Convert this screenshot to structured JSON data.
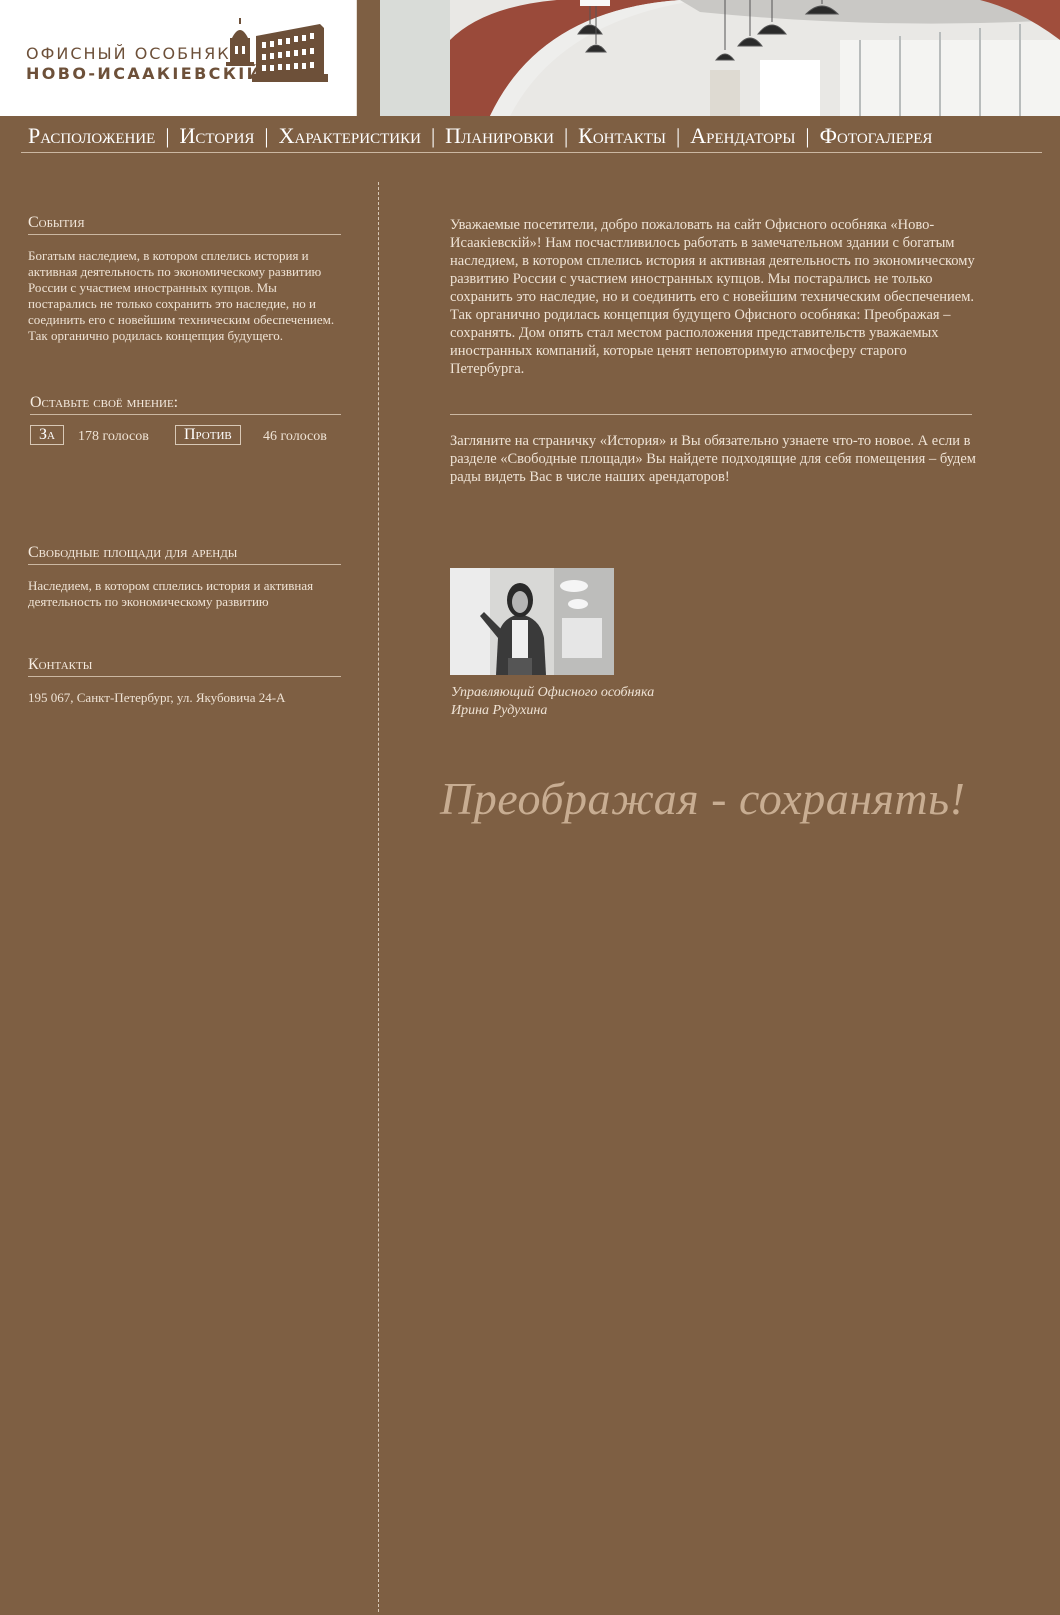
{
  "logo": {
    "line1": "ОФИСНЫЙ ОСОБНЯК",
    "line2": "НОВО-ИСААКІЕВСКІЙ"
  },
  "nav": [
    "Расположение",
    "История",
    "Характеристики",
    "Планировки",
    "Контакты",
    "Арендаторы",
    "Фотогалерея"
  ],
  "nav_separator": "|",
  "sidebar": {
    "events": {
      "title": "События",
      "text": "Богатым наследием, в котором сплелись история и активная деятельность по экономическому развитию России с участием иностранных купцов. Мы постарались не только сохранить это наследие, но и соединить его с новейшим техническим обеспечением. Так органично родилась концепция будущего."
    },
    "poll": {
      "title": "Оставьте своё мнение:",
      "for_label": "За",
      "for_count": "178 голосов",
      "against_label": "Против",
      "against_count": "46 голосов"
    },
    "free_space": {
      "title": "Свободные площади для аренды",
      "text": "Наследием, в котором сплелись история и активная деятельность по экономическому развитию"
    },
    "contacts": {
      "title": "Контакты",
      "address": "195 067, Санкт-Петербург, ул. Якубовича 24-А"
    }
  },
  "main": {
    "welcome": "Уважаемые посетители, добро пожаловать на сайт Офисного особняка «Ново-Исаакіевскій»! Нам посчастливилось работать в замечательном здании с богатым наследием, в котором сплелись история и активная деятельность по экономическому развитию России с участием иностранных купцов. Мы постарались не только сохранить это наследие, но и соединить его с новейшим техническим обеспечением. Так органично родилась концепция будущего Офисного особняка: Преображая – сохранять. Дом опять стал местом расположения представительств уважаемых иностранных компаний, которые ценят неповторимую атмосферу старого Петербурга.",
    "invite": "Загляните на страничку «История» и Вы обязательно узнаете что-то новое. А если в разделе «Свободные площади» Вы найдете подходящие для себя помещения – будем рады видеть Вас в числе наших арендаторов!",
    "caption_role": "Управляющий Офисного особняка",
    "caption_name": "Ирина Рудухина",
    "slogan": "Преображая - сохранять!"
  },
  "colors": {
    "background": "#7e5f43",
    "accent": "#c8ad92",
    "text": "#efe3d5"
  },
  "icons": [
    "building-logo-icon",
    "interior-photo",
    "manager-portrait-photo"
  ]
}
